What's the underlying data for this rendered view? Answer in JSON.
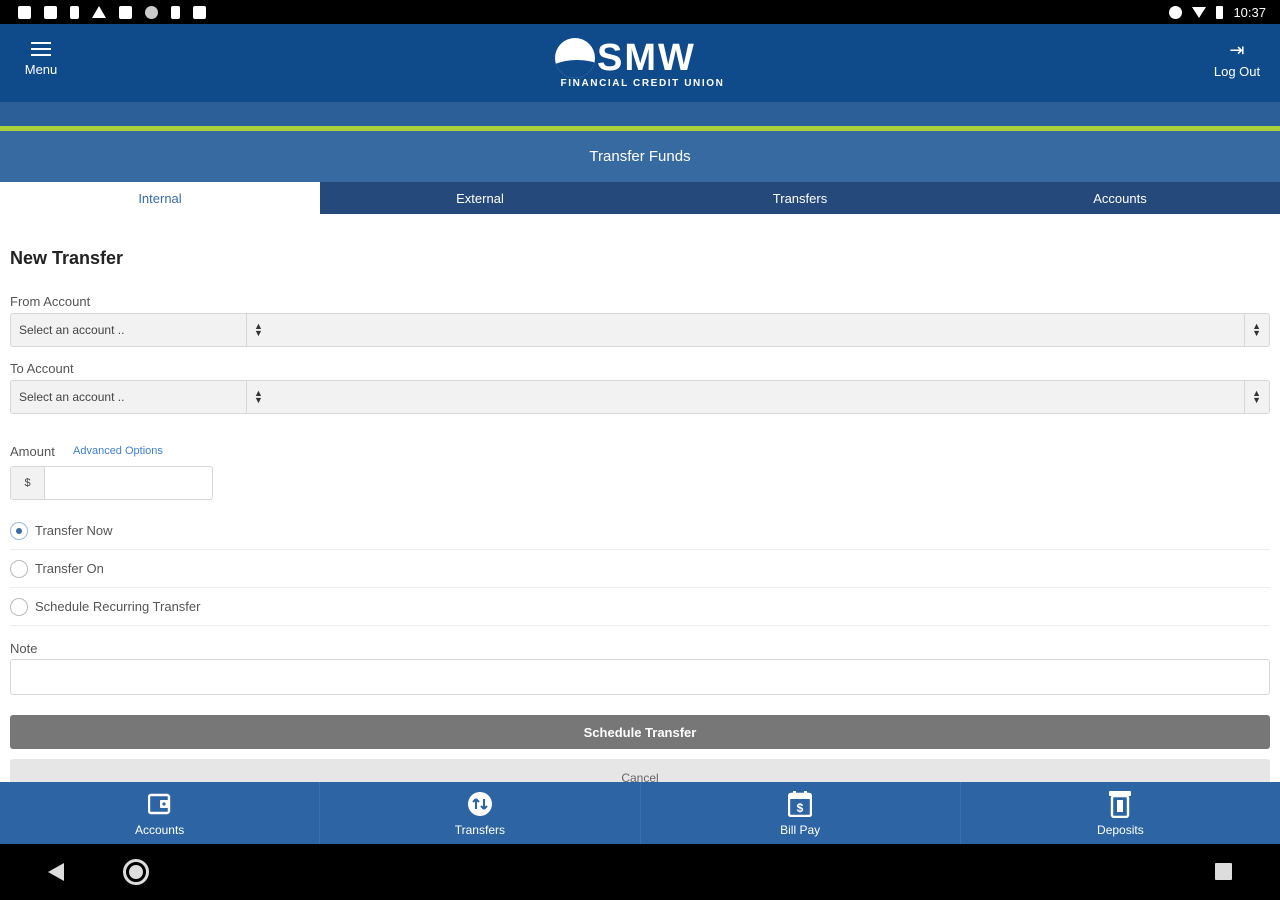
{
  "status_bar": {
    "time": "10:37",
    "left_icons": [
      "photo-icon",
      "gallery-icon",
      "person-icon",
      "warning-icon",
      "calendar-icon",
      "security-icon",
      "phone-icon",
      "play-store-icon"
    ],
    "right_icons": [
      "do-not-disturb-icon",
      "wifi-icon",
      "battery-icon"
    ]
  },
  "header": {
    "menu_label": "Menu",
    "logout_label": "Log Out",
    "logo_text": "SMW",
    "logo_subtext": "FINANCIAL CREDIT UNION",
    "brand_color": "#0f4a8a",
    "accent_color": "#a9cf3b"
  },
  "page": {
    "title": "Transfer Funds",
    "tabs": [
      {
        "label": "Internal",
        "active": true
      },
      {
        "label": "External",
        "active": false
      },
      {
        "label": "Transfers",
        "active": false
      },
      {
        "label": "Accounts",
        "active": false
      }
    ]
  },
  "form": {
    "heading": "New Transfer",
    "from_label": "From Account",
    "from_placeholder": "Select an account ..",
    "to_label": "To Account",
    "to_placeholder": "Select an account ..",
    "amount_label": "Amount",
    "advanced_options_label": "Advanced Options",
    "currency_symbol": "$",
    "amount_value": "",
    "radio_options": [
      {
        "label": "Transfer Now",
        "checked": true
      },
      {
        "label": "Transfer On",
        "checked": false
      },
      {
        "label": "Schedule Recurring Transfer",
        "checked": false
      }
    ],
    "note_label": "Note",
    "note_value": "",
    "submit_label": "Schedule Transfer",
    "cancel_label": "Cancel"
  },
  "bottom_nav": [
    {
      "label": "Accounts",
      "icon": "wallet-icon"
    },
    {
      "label": "Transfers",
      "icon": "transfer-icon"
    },
    {
      "label": "Bill Pay",
      "icon": "calendar-dollar-icon"
    },
    {
      "label": "Deposits",
      "icon": "deposit-icon"
    }
  ]
}
